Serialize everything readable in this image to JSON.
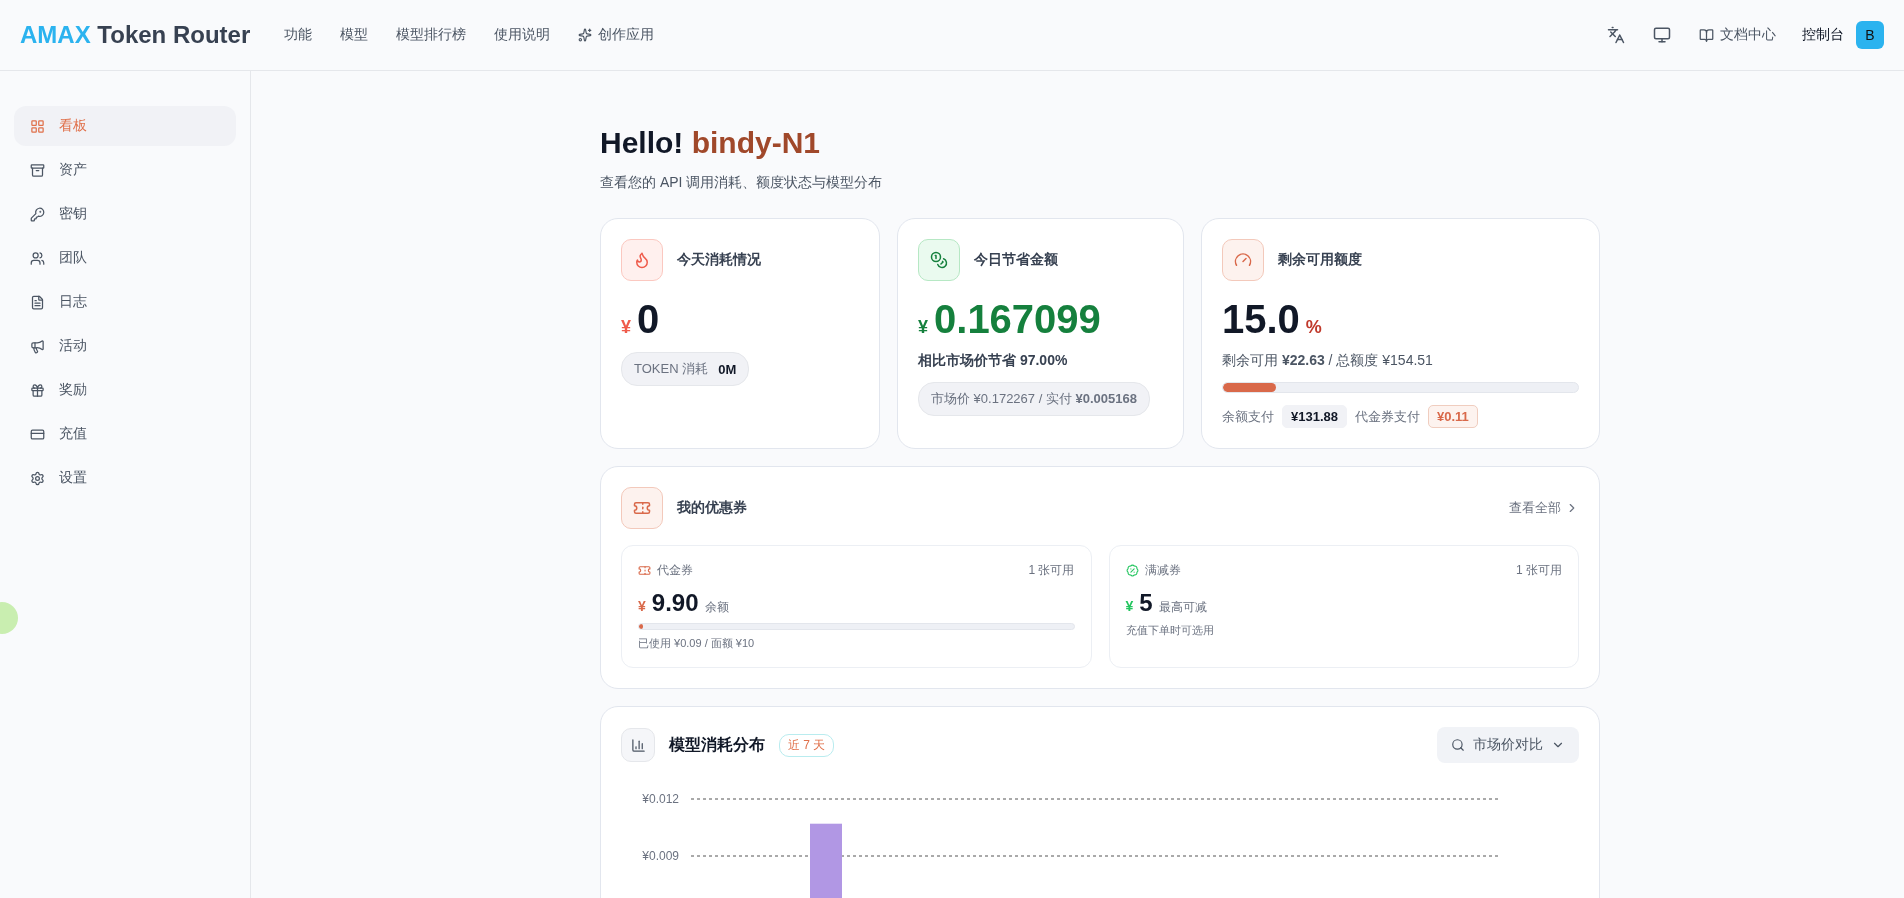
{
  "header": {
    "logo_accent": "AMAX",
    "logo_rest": "Token Router",
    "nav": [
      {
        "label": "功能",
        "kind": "text"
      },
      {
        "label": "模型",
        "kind": "text"
      },
      {
        "label": "模型排行榜",
        "kind": "text"
      },
      {
        "label": "使用说明",
        "kind": "text"
      },
      {
        "label": "创作应用",
        "kind": "icon"
      }
    ],
    "docs_link": "文档中心",
    "console_link": "控制台",
    "avatar": "B"
  },
  "sidebar": {
    "items": [
      {
        "label": "看板",
        "selected": true
      },
      {
        "label": "资产",
        "selected": false
      },
      {
        "label": "密钥",
        "selected": false
      },
      {
        "label": "团队",
        "selected": false
      },
      {
        "label": "日志",
        "selected": false
      },
      {
        "label": "活动",
        "selected": false
      },
      {
        "label": "奖励",
        "selected": false
      },
      {
        "label": "充值",
        "selected": false
      },
      {
        "label": "设置",
        "selected": false
      }
    ]
  },
  "greeting": {
    "hello": "Hello!",
    "name": "bindy-N1",
    "subtitle": "查看您的 API 调用消耗、额度状态与模型分布"
  },
  "today_cost": {
    "title": "今天消耗情况",
    "currency": "¥",
    "value": "0",
    "token_label": "TOKEN 消耗",
    "token_value": "0M"
  },
  "savings": {
    "title": "今日节省金额",
    "currency": "¥",
    "value": "0.167099",
    "compare": "相比市场价节省 **97.00%**",
    "prices": "市场价 ¥0.172267 / 实付 **¥0.005168**"
  },
  "quota": {
    "title": "剩余可用额度",
    "value": "15.0",
    "unit": "%",
    "remaining": "剩余可用 **¥22.63** / 总额度 ¥154.51",
    "level": 0.15,
    "balance_label": "余额支付",
    "balance_value": "¥131.88",
    "voucher_label": "代金券支付",
    "voucher_value": "¥0.11"
  },
  "coupons": {
    "title": "我的优惠券",
    "view_all": "查看全部",
    "items": [
      {
        "kind": "voucher",
        "name": "代金券",
        "count": "1 张可用",
        "currency": "¥",
        "value": "9.90",
        "value_note": "余额",
        "level": 0.01,
        "detail": "已使用 ¥0.09 / 面额 ¥10"
      },
      {
        "kind": "discount",
        "name": "满减券",
        "count": "1 张可用",
        "currency": "¥",
        "value": "5",
        "value_note": "最高可减",
        "detail": "充值下单时可选用"
      }
    ]
  },
  "distribution": {
    "title": "模型消耗分布",
    "period": "近 7 天",
    "filter": "市场价对比",
    "chart_data": {
      "type": "bar",
      "values": [
        0.0107
      ],
      "ylim": [
        0,
        0.012
      ],
      "yticks": [
        {
          "value": 0.012,
          "label": "¥0.012"
        },
        {
          "value": 0.009,
          "label": "¥0.009"
        }
      ]
    }
  }
}
